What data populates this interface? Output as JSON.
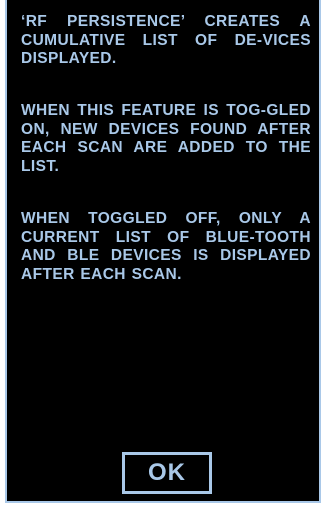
{
  "dialog": {
    "paragraphs": [
      "‘RF PERSISTENCE’ CREATES A CUMULATIVE LIST OF DE-VICES DISPLAYED.",
      "WHEN THIS FEATURE IS TOG-GLED ON, NEW DEVICES FOUND AFTER EACH SCAN ARE ADDED TO THE LIST.",
      "WHEN TOGGLED OFF, ONLY A CURRENT LIST OF BLUE-TOOTH AND BLE DEVICES IS DISPLAYED AFTER EACH SCAN."
    ],
    "ok_label": "OK"
  },
  "colors": {
    "background": "#000000",
    "text": "#a9c8e8",
    "border": "#a9c8e8"
  }
}
